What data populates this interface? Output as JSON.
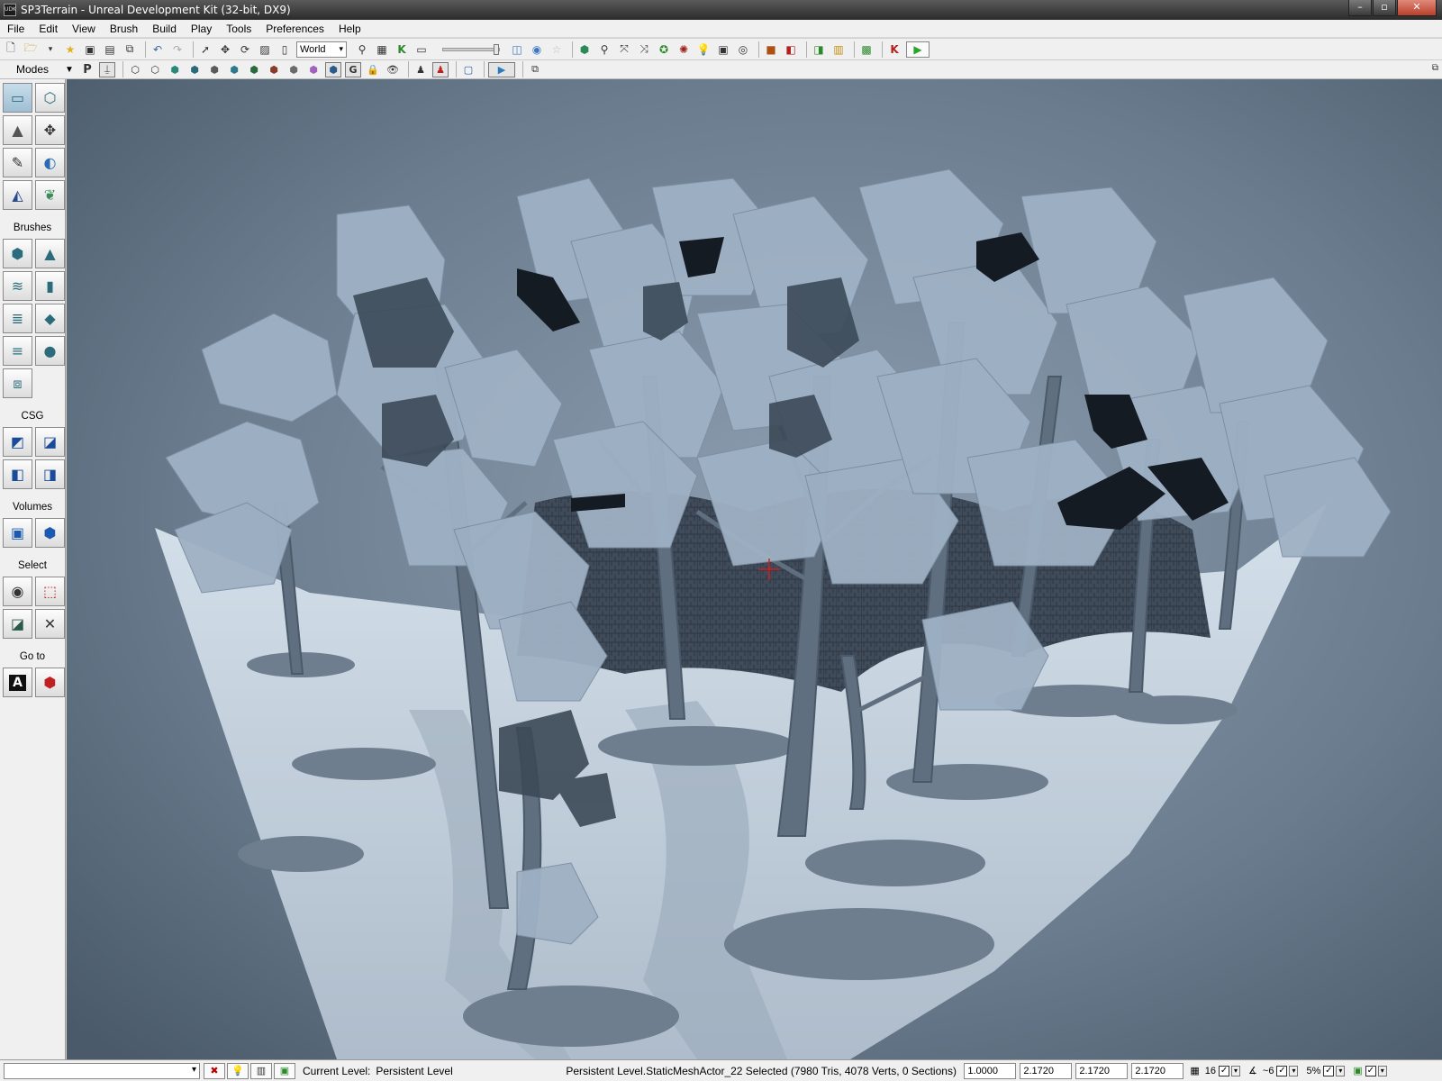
{
  "window": {
    "title": "SP3Terrain - Unreal Development Kit (32-bit, DX9)",
    "app_icon_text": "UDK",
    "minimize": "–",
    "maximize": "▫",
    "close": "✕"
  },
  "menu": [
    "File",
    "Edit",
    "View",
    "Brush",
    "Build",
    "Play",
    "Tools",
    "Preferences",
    "Help"
  ],
  "toolbar": {
    "coordinate_system": "World",
    "play_icon": "play-in-editor-icon"
  },
  "toolbar2": {
    "modes_label": "Modes"
  },
  "left_panel": {
    "sections": {
      "brushes": "Brushes",
      "csg": "CSG",
      "volumes": "Volumes",
      "select": "Select",
      "goto": "Go to"
    },
    "goto_actor_glyph": "A"
  },
  "status_bar": {
    "current_level_label": "Current Level:",
    "current_level_value": "Persistent Level",
    "selection_info": "Persistent Level.StaticMeshActor_22 Selected (7980 Tris, 4078 Verts, 0 Sections)",
    "drawscale": "1.0000",
    "scale_x": "2.1720",
    "scale_y": "2.1720",
    "scale_z": "2.1720",
    "grid_size": "16",
    "rotation_snap": "~6",
    "scale_snap": "5%"
  },
  "colors": {
    "viewport_bg": "#4c5c6c",
    "snow": "#c8d6e2",
    "foliage": "#8fa4b8",
    "trunk": "#5a6a7a",
    "wall": "#3a4654"
  }
}
